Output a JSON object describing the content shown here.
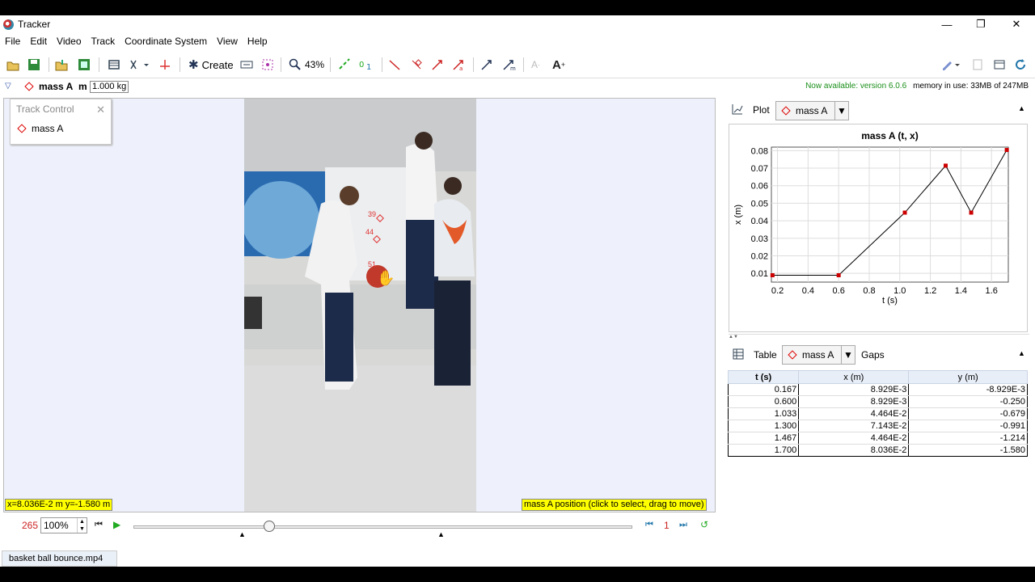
{
  "window": {
    "title": "Tracker"
  },
  "menu": [
    "File",
    "Edit",
    "Video",
    "Track",
    "Coordinate System",
    "View",
    "Help"
  ],
  "toolbar": {
    "create": "Create",
    "zoom": "43%"
  },
  "trackbar": {
    "track": "mass A",
    "mass_label": "m",
    "mass_value": "1.000 kg",
    "available": "Now available: version 6.0.6",
    "memory": "memory in use: 33MB of 247MB"
  },
  "track_control": {
    "title": "Track Control",
    "item": "mass A"
  },
  "video_labels": [
    "39",
    "44",
    "51"
  ],
  "readout": {
    "coords": "x=8.036E-2 m  y=-1.580 m",
    "hint": "mass A position (click to select, drag to move)"
  },
  "player": {
    "frame": "265",
    "zoom": "100%",
    "step": "1"
  },
  "file_tab": "basket ball bounce.mp4",
  "plot_panel": {
    "label": "Plot",
    "track": "mass A"
  },
  "table_panel": {
    "label": "Table",
    "track": "mass A",
    "gaps": "Gaps",
    "headers": [
      "t (s)",
      "x (m)",
      "y (m)"
    ],
    "rows": [
      [
        "0.167",
        "8.929E-3",
        "-8.929E-3"
      ],
      [
        "0.600",
        "8.929E-3",
        "-0.250"
      ],
      [
        "1.033",
        "4.464E-2",
        "-0.679"
      ],
      [
        "1.300",
        "7.143E-2",
        "-0.991"
      ],
      [
        "1.467",
        "4.464E-2",
        "-1.214"
      ],
      [
        "1.700",
        "8.036E-2",
        "-1.580"
      ]
    ]
  },
  "chart_data": {
    "type": "line",
    "title": "mass A (t, x)",
    "xlabel": "t (s)",
    "ylabel": "x (m)",
    "xlim": [
      0.16,
      1.71
    ],
    "ylim": [
      0.005,
      0.082
    ],
    "xticks": [
      "0.2",
      "0.4",
      "0.6",
      "0.8",
      "1.0",
      "1.2",
      "1.4",
      "1.6"
    ],
    "yticks": [
      "0.01",
      "0.02",
      "0.03",
      "0.04",
      "0.05",
      "0.06",
      "0.07",
      "0.08"
    ],
    "x": [
      0.167,
      0.6,
      1.033,
      1.3,
      1.467,
      1.7
    ],
    "y": [
      0.008929,
      0.008929,
      0.04464,
      0.07143,
      0.04464,
      0.08036
    ],
    "grid": true,
    "color": "#cc0000"
  }
}
